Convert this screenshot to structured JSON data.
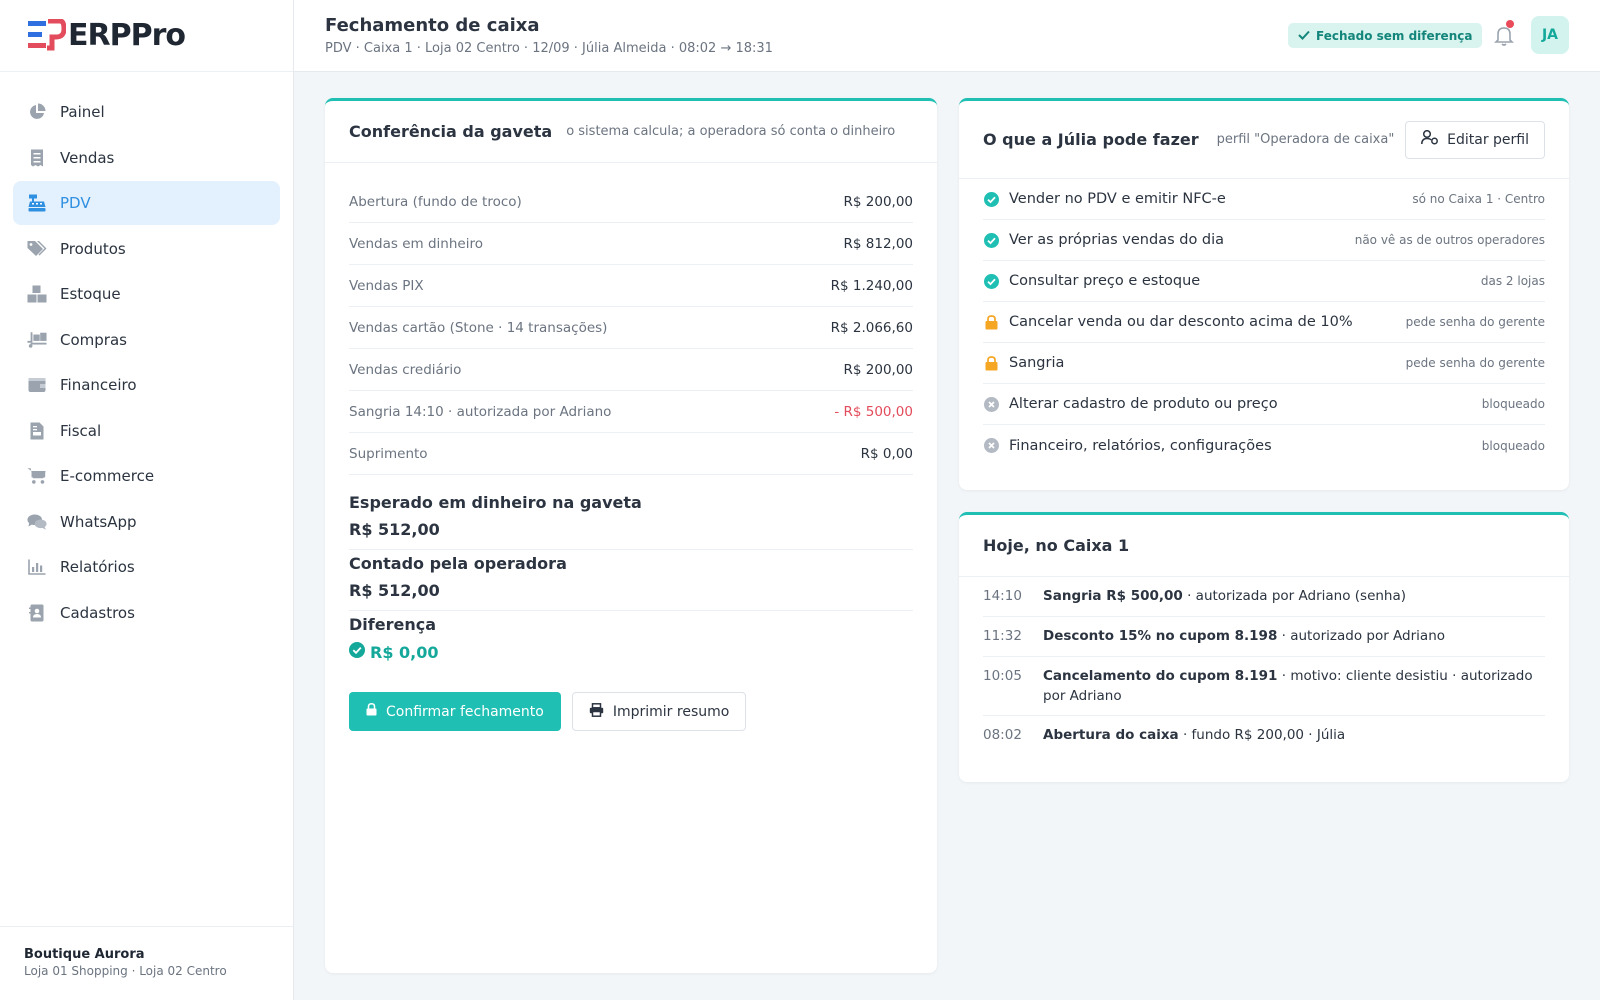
{
  "brand": {
    "name": "ERPPro",
    "accent": "#1fc0b3",
    "blue": "#2f8fe0"
  },
  "sidebar": {
    "items": [
      {
        "label": "Painel",
        "icon": "pie-chart-icon",
        "active": false
      },
      {
        "label": "Vendas",
        "icon": "receipt-icon",
        "active": false
      },
      {
        "label": "PDV",
        "icon": "cash-register-icon",
        "active": true
      },
      {
        "label": "Produtos",
        "icon": "tags-icon",
        "active": false
      },
      {
        "label": "Estoque",
        "icon": "boxes-icon",
        "active": false
      },
      {
        "label": "Compras",
        "icon": "truck-loading-icon",
        "active": false
      },
      {
        "label": "Financeiro",
        "icon": "wallet-icon",
        "active": false
      },
      {
        "label": "Fiscal",
        "icon": "invoice-icon",
        "active": false
      },
      {
        "label": "E-commerce",
        "icon": "cart-icon",
        "active": false
      },
      {
        "label": "WhatsApp",
        "icon": "chat-icon",
        "active": false
      },
      {
        "label": "Relatórios",
        "icon": "bar-chart-icon",
        "active": false
      },
      {
        "label": "Cadastros",
        "icon": "address-book-icon",
        "active": false
      }
    ],
    "footer": {
      "store": "Boutique Aurora",
      "locations": "Loja 01 Shopping · Loja 02 Centro"
    }
  },
  "header": {
    "title": "Fechamento de caixa",
    "subtitle": "PDV · Caixa 1 · Loja 02 Centro · 12/09 · Júlia Almeida · 08:02 → 18:31",
    "status": "Fechado sem diferença",
    "avatar": "JA"
  },
  "drawer": {
    "title": "Conferência da gaveta",
    "hint": "o sistema calcula; a operadora só conta o dinheiro",
    "rows": [
      {
        "label": "Abertura (fundo de troco)",
        "value": "R$ 200,00"
      },
      {
        "label": "Vendas em dinheiro",
        "value": "R$ 812,00"
      },
      {
        "label": "Vendas PIX",
        "value": "R$ 1.240,00"
      },
      {
        "label": "Vendas cartão (Stone · 14 transações)",
        "value": "R$ 2.066,60"
      },
      {
        "label": "Vendas crediário",
        "value": "R$ 200,00"
      },
      {
        "label": "Sangria 14:10 · autorizada por Adriano",
        "value": "- R$ 500,00"
      },
      {
        "label": "Suprimento",
        "value": "R$ 0,00"
      }
    ],
    "expected_label": "Esperado em dinheiro na gaveta",
    "expected_value": "R$ 512,00",
    "counted_label": "Contado pela operadora",
    "counted_value": "R$ 512,00",
    "diff_label": "Diferença",
    "diff_value": "R$ 0,00",
    "confirm_label": "Confirmar fechamento",
    "print_label": "Imprimir resumo"
  },
  "permissions": {
    "title": "O que a Júlia pode fazer",
    "profile": "perfil \"Operadora de caixa\"",
    "edit_label": "Editar perfil",
    "items": [
      {
        "label": "Vender no PDV e emitir NFC-e",
        "note": "só no Caixa 1 · Centro",
        "status": "allowed"
      },
      {
        "label": "Ver as próprias vendas do dia",
        "note": "não vê as de outros operadores",
        "status": "allowed"
      },
      {
        "label": "Consultar preço e estoque",
        "note": "das 2 lojas",
        "status": "allowed"
      },
      {
        "label": "Cancelar venda ou dar desconto acima de 10%",
        "note": "pede senha do gerente",
        "status": "locked"
      },
      {
        "label": "Sangria",
        "note": "pede senha do gerente",
        "status": "locked"
      },
      {
        "label": "Alterar cadastro de produto ou preço",
        "note": "bloqueado",
        "status": "blocked"
      },
      {
        "label": "Financeiro, relatórios, configurações",
        "note": "bloqueado",
        "status": "blocked"
      }
    ]
  },
  "log": {
    "title": "Hoje, no Caixa 1",
    "items": [
      {
        "time": "14:10",
        "bold": "Sangria R$ 500,00",
        "rest": " · autorizada por Adriano (senha)"
      },
      {
        "time": "11:32",
        "bold": "Desconto 15% no cupom 8.198",
        "rest": " · autorizado por Adriano"
      },
      {
        "time": "10:05",
        "bold": "Cancelamento do cupom 8.191",
        "rest": " · motivo: cliente desistiu · autorizado por Adriano"
      },
      {
        "time": "08:02",
        "bold": "Abertura do caixa",
        "rest": " · fundo R$ 200,00 · Júlia"
      }
    ]
  }
}
